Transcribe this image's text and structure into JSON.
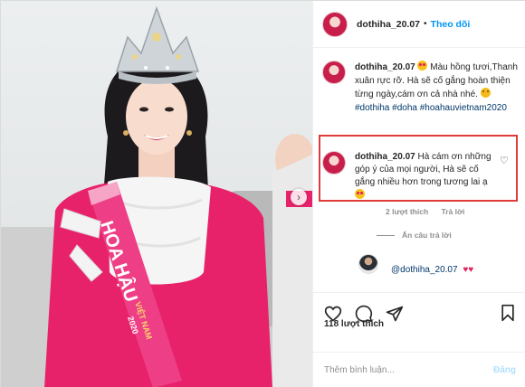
{
  "post": {
    "username": "dothiha_20.07",
    "follow_label": "Theo dõi",
    "separator": "•"
  },
  "caption": {
    "username": "dothiha_20.07",
    "text": "Màu hồng tươi,Thanh xuân rực rỡ. Hà sẽ cố gắng hoàn thiện từng ngày,cám ơn cả nhà nhé.",
    "hashtags": "#dothiha #doha #hoahauvietnam2020"
  },
  "comment": {
    "username": "dothiha_20.07",
    "text": "Hà cám ơn những góp ý của mọi người, Hà sẽ cố gắng nhiều hơn trong tương lai ạ",
    "likes_label": "2 lượt thích",
    "reply_label": "Trả lời",
    "hide_replies_label": "Ẩn câu trả lời"
  },
  "reply": {
    "mention": "@dothiha_20.07",
    "hearts": "♥♥"
  },
  "actions": {
    "likes_count": "118 lượt thích"
  },
  "add_comment": {
    "placeholder": "Thêm bình luận...",
    "post_label": "Đăng"
  },
  "photo": {
    "sash_text": "HOA HẬU",
    "sash_sub": "VIỆT NAM",
    "sash_year": "2020"
  },
  "colors": {
    "accent_blue": "#0095f6",
    "highlight_red": "#e03b3b",
    "heart_red": "#e0245e",
    "dress_pink": "#e8226a"
  },
  "icons": [
    "heart-icon",
    "comment-icon",
    "share-icon",
    "bookmark-icon",
    "chevron-right-icon",
    "small-heart-icon"
  ]
}
